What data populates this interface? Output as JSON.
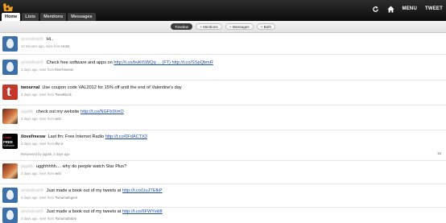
{
  "tabs": [
    {
      "label": "Home"
    },
    {
      "label": "Lists"
    },
    {
      "label": "Mentions"
    },
    {
      "label": "Messages"
    }
  ],
  "header": {
    "menu_label": "MENU",
    "tweet_label": "TWEET"
  },
  "filters": [
    {
      "label": "Timeline"
    },
    {
      "label": "+ Mentions"
    },
    {
      "label": "+ Messages"
    },
    {
      "label": "+ Both"
    }
  ],
  "tweets": [
    {
      "user": "arvindnair8",
      "text": "Hi..",
      "link": "",
      "meta_prefix": "13 minutes ago. Sent from ",
      "source": "Hotot"
    },
    {
      "user": "arvindnair8",
      "text": "Check free software and apps on ",
      "link": "http://t.co/bvKtSWQq ... (FT) http://t.co/SSpQbmR",
      "meta_prefix": "3 days ago. Sent from ",
      "source": "RiseTweeter"
    },
    {
      "user": "twournal",
      "text": "Use coupon code VAL2012 for 15% off until the end of Valentine's day",
      "link": "",
      "meta_prefix": "3 days ago. Sent from ",
      "source": "TweetDeck"
    },
    {
      "user": "jagatk",
      "text": "check out my website ",
      "link": "http://t.co/NGFbIXmO",
      "meta_prefix": "3 days ago. Sent from ",
      "source": "web"
    },
    {
      "user": "ilovefreesw",
      "text": "Last fm: Free Internet Radio ",
      "link": "http://t.co/0FdACTX3",
      "meta_prefix": "3 days ago. Sent from ",
      "source": "dlvr.it",
      "retweet": "Retweeted by jagatk, 3 days ago",
      "count": "16"
    },
    {
      "user": "jagatk",
      "text": "ugghhhhh.... why do people watch Star Plus?",
      "link": "",
      "meta_prefix": "3 days ago. Sent from ",
      "source": "web"
    },
    {
      "user": "arvindnair8",
      "text": "Just made a book out of my tweets at ",
      "link": "http://t.co/UuJTEfkP",
      "meta_prefix": "4 days ago. Sent from ",
      "source": "TwournalAgent"
    },
    {
      "user": "arvindnair8",
      "text": "Just made a book out of my tweets at ",
      "link": "http://t.co/6FWYvkl8",
      "meta_prefix": "4 days ago. Sent from ",
      "source": "TwournalStore"
    }
  ],
  "colors": {
    "topbar": "#1b1b1b",
    "link": "#1b4db0",
    "logo": "#f0a020"
  }
}
